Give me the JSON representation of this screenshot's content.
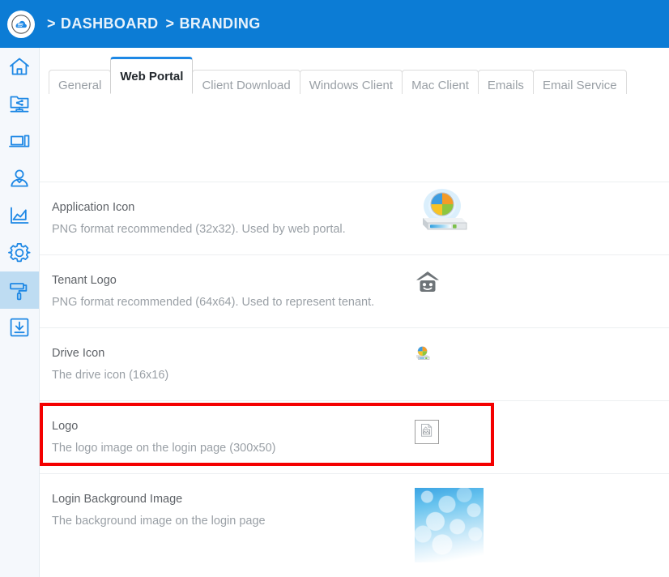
{
  "header": {
    "logo_icon": "cloud-logo-icon",
    "breadcrumb": {
      "separator": ">",
      "items": [
        "DASHBOARD",
        "BRANDING"
      ]
    },
    "background_color": "#0c7cd5"
  },
  "sidebar": {
    "background_color": "#f5f8fc",
    "active_background_color": "#bedcf2",
    "icon_color": "#1e88e5",
    "items": [
      {
        "name": "home",
        "icon": "home-icon",
        "active": false
      },
      {
        "name": "shares",
        "icon": "share-network-icon",
        "active": false
      },
      {
        "name": "devices",
        "icon": "devices-icon",
        "active": false
      },
      {
        "name": "users",
        "icon": "user-icon",
        "active": false
      },
      {
        "name": "reports",
        "icon": "chart-line-icon",
        "active": false
      },
      {
        "name": "settings",
        "icon": "gear-icon",
        "active": false
      },
      {
        "name": "branding",
        "icon": "paint-roller-icon",
        "active": true
      },
      {
        "name": "downloads",
        "icon": "download-box-icon",
        "active": false
      }
    ]
  },
  "tabs": {
    "active_index": 1,
    "active_accent_color": "#1e88e5",
    "items": [
      {
        "label": "General"
      },
      {
        "label": "Web Portal"
      },
      {
        "label": "Client Download"
      },
      {
        "label": "Windows Client"
      },
      {
        "label": "Mac Client"
      },
      {
        "label": "Emails"
      },
      {
        "label": "Email Service"
      }
    ]
  },
  "main": {
    "rows": [
      {
        "title": "Application Icon",
        "description": "PNG format recommended (32x32). Used by web portal.",
        "media": "drive-pie-icon-large",
        "highlighted": false
      },
      {
        "title": "Tenant Logo",
        "description": "PNG format recommended (64x64). Used to represent tenant.",
        "media": "house-tenant-icon",
        "highlighted": false
      },
      {
        "title": "Drive Icon",
        "description": "The drive icon (16x16)",
        "media": "drive-pie-icon-small",
        "highlighted": false
      },
      {
        "title": "Logo",
        "description": "The logo image on the login page (300x50)",
        "media": "broken-image-placeholder",
        "highlighted": true
      },
      {
        "title": "Login Background Image",
        "description": "The background image on the login page",
        "media": "login-background-thumbnail",
        "highlighted": false
      }
    ]
  },
  "annotation": {
    "highlight_color": "#f40000",
    "target_row": "Logo"
  }
}
